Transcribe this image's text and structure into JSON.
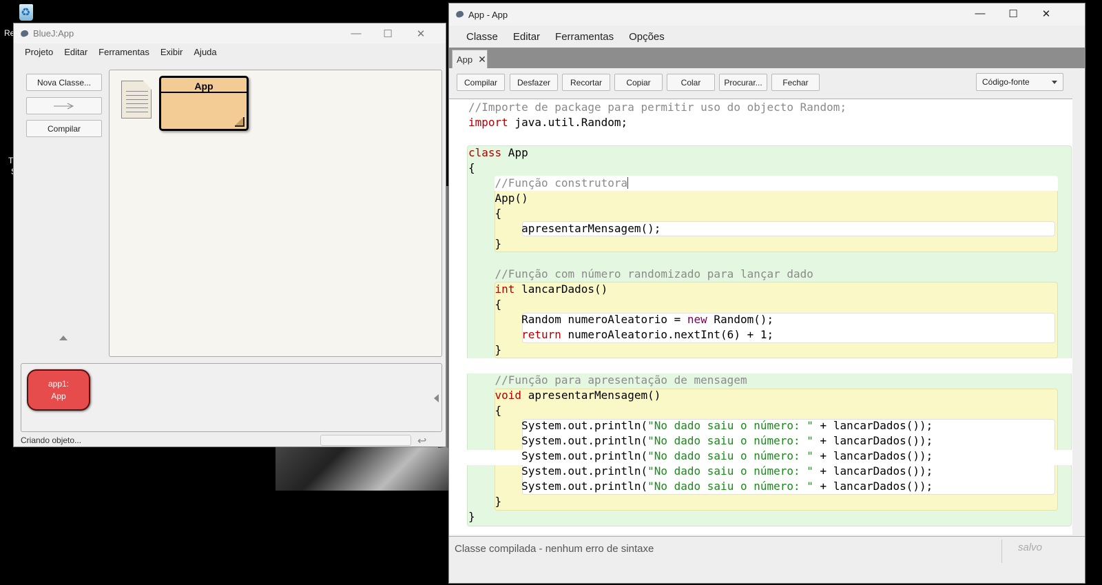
{
  "desktop": {
    "recycle_label": "Re",
    "label_t": "T",
    "label_s": "S"
  },
  "bluej": {
    "title": "BlueJ:App",
    "menu": [
      "Projeto",
      "Editar",
      "Ferramentas",
      "Exibir",
      "Ajuda"
    ],
    "buttons": {
      "new_class": "Nova Classe...",
      "compile": "Compilar"
    },
    "class_name": "App",
    "object": {
      "name": "app1:",
      "type": "App"
    },
    "status": "Criando objeto..."
  },
  "editor": {
    "title": "App - App",
    "menu": [
      "Classe",
      "Editar",
      "Ferramentas",
      "Opções"
    ],
    "tab_label": "App",
    "toolbar": [
      "Compilar",
      "Desfazer",
      "Recortar",
      "Copiar",
      "Colar",
      "Procurar...",
      "Fechar"
    ],
    "view_select": "Código-fonte",
    "status_message": "Classe compilada - nenhum erro de sintaxe",
    "saved_label": "salvo",
    "code": {
      "l1": "//Importe de package para permitir uso do objecto Random;",
      "l2_kw": "import",
      "l2_rest": " java.util.Random;",
      "l4_kw": "class",
      "l4_rest": " App",
      "l5": "{",
      "l6": "    //Função construtora",
      "l7": "    App()",
      "l8": "    {",
      "l9": "        apresentarMensagem();",
      "l10": "    }",
      "l12": "    //Função com número randomizado para lançar dado",
      "l13_kw": "int",
      "l13_rest": " lancarDados()",
      "l14": "    {",
      "l15_a": "        Random numeroAleatorio = ",
      "l15_kw": "new",
      "l15_b": " Random();",
      "l16_kw": "return",
      "l16_rest": " numeroAleatorio.nextInt(6) + 1;",
      "l17": "    }",
      "l19": "    //Função para apresentação de mensagem",
      "l20_kw": "void",
      "l20_rest": " apresentarMensagem()",
      "l21": "    {",
      "println_a": "        System.out.println(",
      "println_str": "\"No dado saiu o número: \"",
      "println_b": " + lancarDados());",
      "l27": "    }",
      "l28": "}"
    }
  }
}
